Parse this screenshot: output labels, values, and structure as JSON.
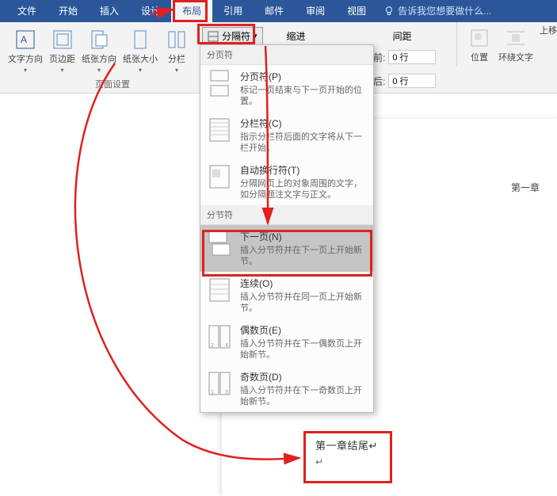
{
  "menubar": {
    "items": [
      "文件",
      "开始",
      "插入",
      "设计",
      "布局",
      "引用",
      "邮件",
      "审阅",
      "视图"
    ],
    "active_index": 4,
    "tell_me": "告诉我您想要做什么..."
  },
  "ribbon": {
    "buttons": [
      {
        "label": "文字方向"
      },
      {
        "label": "页边距"
      },
      {
        "label": "纸张方向"
      },
      {
        "label": "纸张大小"
      },
      {
        "label": "分栏"
      }
    ],
    "breaks_label": "分隔符",
    "indent_label": "缩进",
    "spacing_label": "间距",
    "before_label": "前:",
    "after_label": "后:",
    "before_value": "0 行",
    "after_value": "0 行",
    "position_label": "位置",
    "wrap_label": "环绕文字",
    "forward_label": "上移",
    "group_label_page_setup": "页面设置"
  },
  "dropdown": {
    "section1_label": "分页符",
    "section2_label": "分节符",
    "items_page": [
      {
        "title": "分页符(P)",
        "desc": "标记一页结束与下一页开始的位置。"
      },
      {
        "title": "分栏符(C)",
        "desc": "指示分栏符后面的文字将从下一栏开始。"
      },
      {
        "title": "自动换行符(T)",
        "desc": "分隔网页上的对象周围的文字，如分隔题注文字与正文。"
      }
    ],
    "items_section": [
      {
        "title": "下一页(N)",
        "desc": "插入分节符并在下一页上开始新节。"
      },
      {
        "title": "连续(O)",
        "desc": "插入分节符并在同一页上开始新节。"
      },
      {
        "title": "偶数页(E)",
        "desc": "插入分节符并在下一偶数页上开始新节。"
      },
      {
        "title": "奇数页(D)",
        "desc": "插入分节符并在下一奇数页上开始新节。"
      }
    ],
    "highlighted_index": 0
  },
  "document": {
    "chapter_heading": "第一章",
    "body_text": "第一章结尾"
  }
}
